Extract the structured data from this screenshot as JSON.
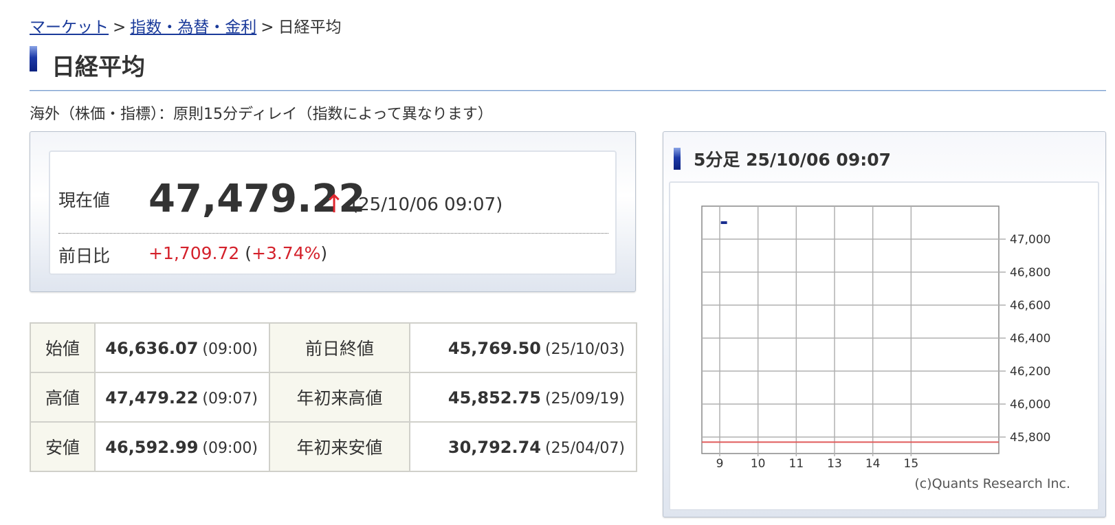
{
  "breadcrumb": {
    "market": "マーケット",
    "sep1": ">",
    "indices": "指数・為替・金利",
    "sep2": ">",
    "current": "日経平均"
  },
  "page_title": "日経平均",
  "delay_note": "海外（株価・指標）：原則15分ディレイ（指数によって異なります）",
  "price": {
    "label": "現在値",
    "value": "47,479.22",
    "arrow": "↑",
    "time": "(25/10/06 09:07)",
    "change_label": "前日比",
    "change_value": "+1,709.72",
    "change_pct_open": "(",
    "change_pct": "+3.74%",
    "change_pct_close": ")"
  },
  "stats": {
    "rows": [
      {
        "l1": "始値",
        "v1": "46,636.07",
        "t1": "(09:00)",
        "l2": "前日終値",
        "v2": "45,769.50",
        "t2": "(25/10/03)"
      },
      {
        "l1": "高値",
        "v1": "47,479.22",
        "t1": "(09:07)",
        "l2": "年初来高値",
        "v2": "45,852.75",
        "t2": "(25/09/19)"
      },
      {
        "l1": "安値",
        "v1": "46,592.99",
        "t1": "(09:00)",
        "l2": "年初来安値",
        "v2": "30,792.74",
        "t2": "(25/04/07)"
      }
    ]
  },
  "chart": {
    "title": "5分足 25/10/06 09:07",
    "copyright": "(c)Quants Research Inc."
  },
  "chart_data": {
    "type": "line",
    "title": "5分足 25/10/06 09:07",
    "x_ticks": [
      "9",
      "10",
      "11",
      "13",
      "14",
      "15"
    ],
    "y_ticks": [
      "47,000",
      "46,800",
      "46,600",
      "46,400",
      "46,200",
      "46,000",
      "45,800"
    ],
    "y_tick_values": [
      47000,
      46800,
      46600,
      46400,
      46200,
      46000,
      45800
    ],
    "ylim": [
      45700,
      47200
    ],
    "previous_close": 45769.5,
    "series": [
      {
        "points": [
          {
            "x": "09:05",
            "y": 47100
          }
        ]
      }
    ],
    "grid": true,
    "colors": {
      "series": "#1a2f8f",
      "previous_close": "#e05a5a",
      "grid": "#b0b0b0"
    }
  }
}
